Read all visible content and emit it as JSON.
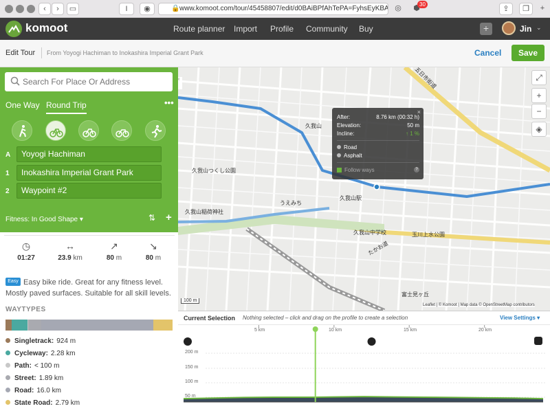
{
  "browser": {
    "url": "www.komoot.com/tour/45458807/edit/d0BAiBPfAhTePA=FyhsEyKBA8kw",
    "badge": "30"
  },
  "nav": {
    "brand": "komoot",
    "links": [
      "Route planner",
      "Import",
      "Profile",
      "Community",
      "Buy"
    ],
    "user": "Jin"
  },
  "editbar": {
    "title": "Edit Tour",
    "subtitle": "From Yoyogi Hachiman to Inokashira Imperial Grant Park",
    "cancel": "Cancel",
    "save": "Save"
  },
  "planner": {
    "search_placeholder": "Search For Place Or Address",
    "tabs": [
      "One Way",
      "Round Trip"
    ],
    "selected_tab": "Round Trip",
    "sports": [
      "hiking-icon",
      "road-bike-icon",
      "bike-touring-icon",
      "mountain-bike-icon",
      "running-icon"
    ],
    "selected_sport": 1,
    "waypoints": [
      {
        "label": "A",
        "name": "Yoyogi Hachiman"
      },
      {
        "label": "1",
        "name": "Inokashira Imperial Grant Park"
      },
      {
        "label": "2",
        "name": "Waypoint #2"
      }
    ],
    "fitness": "Fitness: In Good Shape"
  },
  "stats": {
    "duration": "01:27",
    "distance": "23.9",
    "distance_unit": "km",
    "uphill": "80",
    "uphill_unit": "m",
    "downhill": "80",
    "downhill_unit": "m"
  },
  "difficulty": {
    "badge": "Easy",
    "text": "Easy bike ride. Great for any fitness level. Mostly paved surfaces. Suitable for all skill levels."
  },
  "waytypes": {
    "title": "WAYTYPES",
    "colors": [
      "#9b7a5a",
      "#4aa9a0",
      "#c8c8c8",
      "#a9aab0",
      "#a5a8b3",
      "#e3c46a"
    ],
    "shares": [
      0.039,
      0.095,
      0.004,
      0.079,
      0.67,
      0.117
    ],
    "items": [
      {
        "name": "Singletrack:",
        "value": "924 m",
        "color": "#9b7a5a"
      },
      {
        "name": "Cycleway:",
        "value": "2.28 km",
        "color": "#4aa9a0"
      },
      {
        "name": "Path:",
        "value": "< 100 m",
        "color": "#c8c8c8"
      },
      {
        "name": "Street:",
        "value": "1.89 km",
        "color": "#a9aab0"
      },
      {
        "name": "Road:",
        "value": "16.0 km",
        "color": "#a5a8b3"
      },
      {
        "name": "State Road:",
        "value": "2.79 km",
        "color": "#e3c46a"
      }
    ]
  },
  "map": {
    "scale": "100 m",
    "attribution": "Leaflet | © Komoot | Map data © OpenStreetMap contributors",
    "labels": [
      "五日市街道",
      "久我山",
      "久我山駅",
      "うえみち",
      "たかお道",
      "富士見ヶ丘",
      "久我山つくし公園",
      "久我山稲荷神社",
      "玉川上水公園",
      "久我山中学校"
    ]
  },
  "tooltip": {
    "after_label": "After:",
    "after_value": "8.76 km (00:32 h)",
    "elevation_label": "Elevation:",
    "elevation_value": "50 m",
    "incline_label": "Incline:",
    "incline_value": "↑ 1 %",
    "surface": "Road",
    "waytype": "Asphalt",
    "follow": "Follow ways"
  },
  "elevation": {
    "current_selection": "Current Selection",
    "hint": "Nothing selected – click and drag on the profile to create a selection",
    "view_settings": "View Settings",
    "y_ticks": [
      "200 m",
      "150 m",
      "100 m",
      "50 m"
    ],
    "x_ticks": [
      "5 km",
      "10 km",
      "15 km",
      "20 km"
    ]
  },
  "chart_data": {
    "type": "area",
    "title": "",
    "xlabel": "",
    "ylabel": "",
    "xlim": [
      0,
      23.9
    ],
    "ylim": [
      40,
      220
    ],
    "series": [
      {
        "x": [
          0,
          2,
          4,
          6,
          8,
          8.76,
          10,
          12,
          14,
          16,
          18,
          20,
          22,
          23.9
        ],
        "values": [
          45,
          47,
          49,
          50,
          50,
          50,
          51,
          52,
          51,
          50,
          49,
          48,
          47,
          45
        ]
      }
    ]
  }
}
